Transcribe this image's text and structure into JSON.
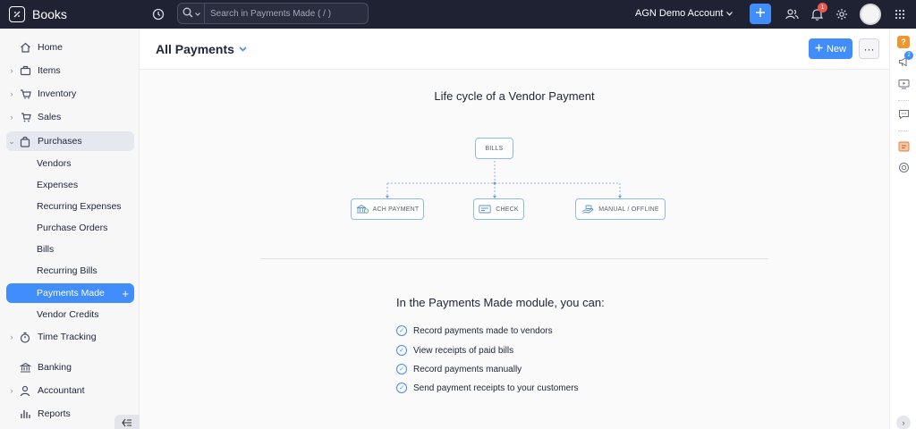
{
  "topbar": {
    "app_name": "Books",
    "search_placeholder": "Search in Payments Made ( / )",
    "org_name": "AGN Demo Account",
    "notification_count": "1",
    "icons": [
      "books-logo-icon",
      "history-icon",
      "search-icon",
      "add-icon",
      "users-icon",
      "bell-icon",
      "gear-icon",
      "apps-grid-icon"
    ]
  },
  "sidebar": {
    "home": "Home",
    "items": "Items",
    "inventory": "Inventory",
    "sales": "Sales",
    "purchases": "Purchases",
    "purchases_sub": [
      "Vendors",
      "Expenses",
      "Recurring Expenses",
      "Purchase Orders",
      "Bills",
      "Recurring Bills",
      "Payments Made",
      "Vendor Credits"
    ],
    "time_tracking": "Time Tracking",
    "banking": "Banking",
    "accountant": "Accountant",
    "reports": "Reports"
  },
  "header": {
    "title": "All Payments",
    "new_label": "New",
    "more_label": "···"
  },
  "lifecycle": {
    "title": "Life cycle of a Vendor Payment",
    "root": "BILLS",
    "branches": [
      "ACH PAYMENT",
      "CHECK",
      "MANUAL / OFFLINE"
    ]
  },
  "module": {
    "heading": "In the Payments Made module, you can:",
    "features": [
      "Record payments made to vendors",
      "View receipts of paid bills",
      "Record payments manually",
      "Send payment receipts to your customers"
    ]
  },
  "rail": {
    "help_label": "?",
    "announcements_count": "2"
  },
  "colors": {
    "topbar_bg": "#1f2233",
    "accent": "#408dfb",
    "help_orange": "#f0962b",
    "badge_red": "#e85a4f"
  }
}
